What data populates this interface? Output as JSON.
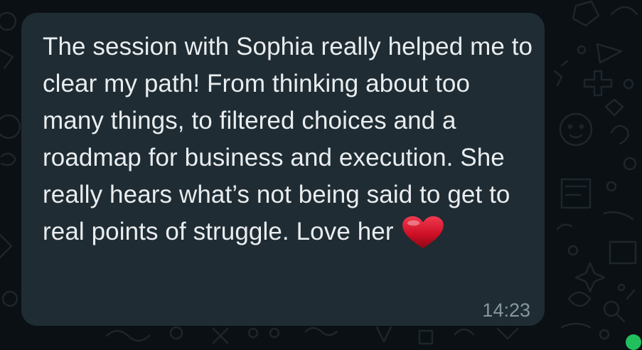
{
  "chat": {
    "message": {
      "text": "The session with Sophia really helped me to clear my path! From thinking about too many things, to filtered choices and a roadmap for business and execution. She really hears what’s not being said to get to real points of struggle. Love her",
      "emoji_icon": "red-heart-icon",
      "time": "14:23"
    }
  },
  "colors": {
    "wallpaper": "#0b1014",
    "bubble": "#1f2c33",
    "message_text": "#e9edef",
    "timestamp": "#8696a0",
    "heart": "#d3132b"
  }
}
